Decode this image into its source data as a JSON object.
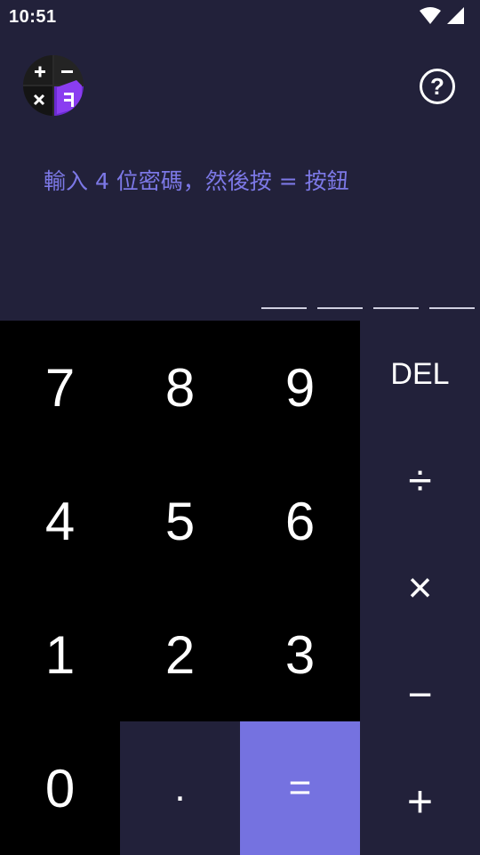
{
  "status_bar": {
    "time": "10:51",
    "icons": [
      "wifi-icon",
      "signal-icon"
    ]
  },
  "header": {
    "logo_icon": "calculator-vault-logo",
    "help_label": "?"
  },
  "instruction": "輸入 4 位密碼，然後按 = 按鈕",
  "pin": {
    "length": 4,
    "entered": 0
  },
  "keypad": {
    "row1": [
      "7",
      "8",
      "9"
    ],
    "row2": [
      "4",
      "5",
      "6"
    ],
    "row3": [
      "1",
      "2",
      "3"
    ],
    "row4": [
      "0",
      ".",
      "="
    ]
  },
  "operators": [
    "DEL",
    "÷",
    "×",
    "−",
    "+"
  ],
  "colors": {
    "background": "#22213a",
    "keypad": "#000000",
    "accent": "#7572e0",
    "instruction": "#7c78e6"
  }
}
